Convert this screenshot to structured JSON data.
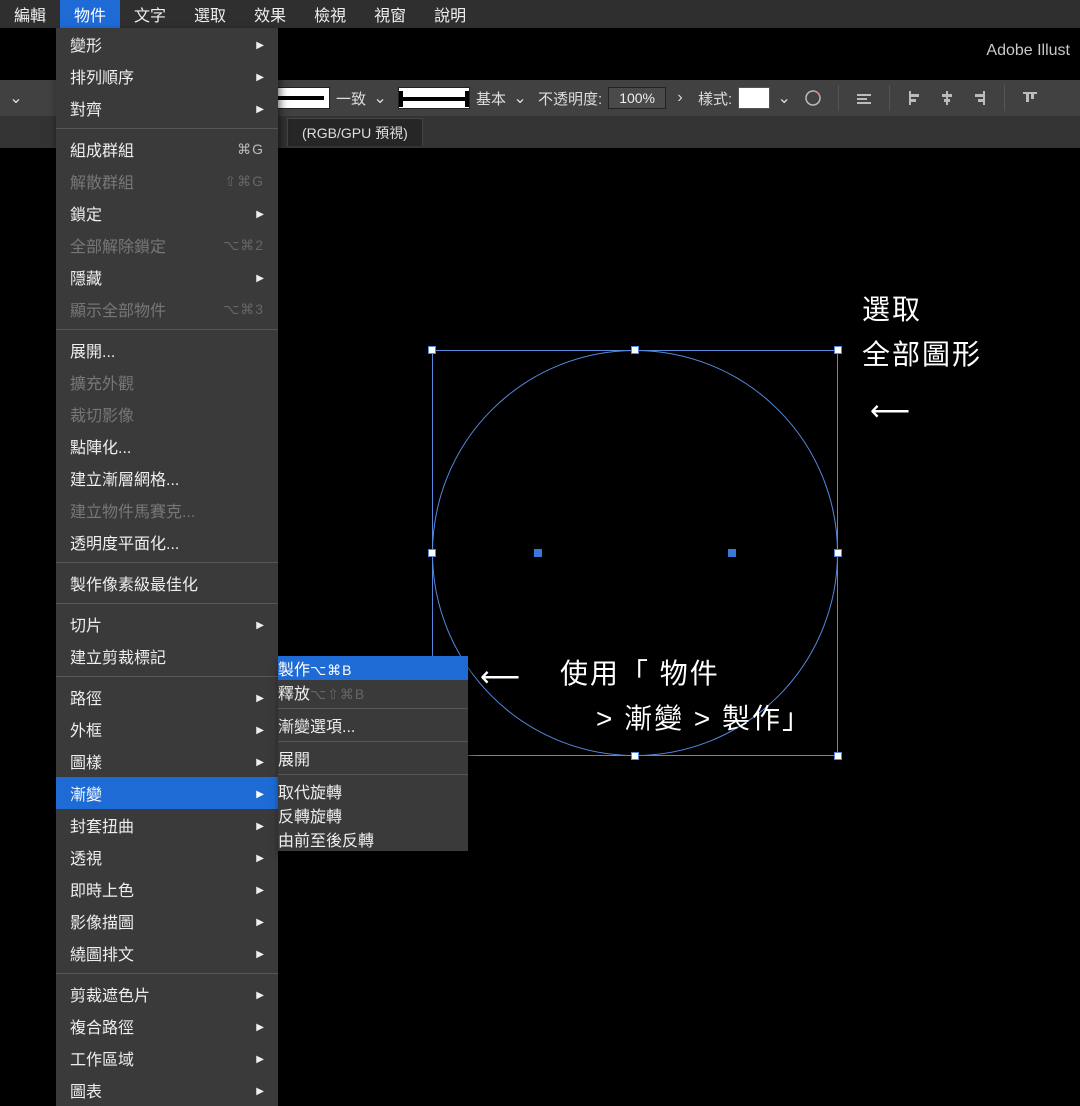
{
  "app": {
    "title": "Adobe Illust"
  },
  "menubar": {
    "items": [
      "編輯",
      "物件",
      "文字",
      "選取",
      "效果",
      "檢視",
      "視窗",
      "說明"
    ],
    "active_index": 1
  },
  "toolbar": {
    "stroke_preview_label": "一致",
    "profile_label": "基本",
    "opacity_label": "不透明度:",
    "opacity_value": "100%",
    "style_label": "樣式:"
  },
  "document": {
    "left_label": "預視)",
    "tab": "(RGB/GPU 預視)"
  },
  "menu": {
    "groups": [
      [
        {
          "label": "變形",
          "arrow": true
        },
        {
          "label": "排列順序",
          "arrow": true
        },
        {
          "label": "對齊",
          "arrow": true
        }
      ],
      [
        {
          "label": "組成群組",
          "shortcut": "⌘G"
        },
        {
          "label": "解散群組",
          "shortcut": "⇧⌘G",
          "disabled": true
        },
        {
          "label": "鎖定",
          "arrow": true
        },
        {
          "label": "全部解除鎖定",
          "shortcut": "⌥⌘2",
          "disabled": true
        },
        {
          "label": "隱藏",
          "arrow": true
        },
        {
          "label": "顯示全部物件",
          "shortcut": "⌥⌘3",
          "disabled": true
        }
      ],
      [
        {
          "label": "展開..."
        },
        {
          "label": "擴充外觀",
          "disabled": true
        },
        {
          "label": "裁切影像",
          "disabled": true
        },
        {
          "label": "點陣化..."
        },
        {
          "label": "建立漸層網格..."
        },
        {
          "label": "建立物件馬賽克...",
          "disabled": true
        },
        {
          "label": "透明度平面化..."
        }
      ],
      [
        {
          "label": "製作像素級最佳化"
        }
      ],
      [
        {
          "label": "切片",
          "arrow": true
        },
        {
          "label": "建立剪裁標記"
        }
      ],
      [
        {
          "label": "路徑",
          "arrow": true
        },
        {
          "label": "外框",
          "arrow": true
        },
        {
          "label": "圖樣",
          "arrow": true
        },
        {
          "label": "漸變",
          "arrow": true,
          "highlight": true
        },
        {
          "label": "封套扭曲",
          "arrow": true
        },
        {
          "label": "透視",
          "arrow": true
        },
        {
          "label": "即時上色",
          "arrow": true
        },
        {
          "label": "影像描圖",
          "arrow": true
        },
        {
          "label": "繞圖排文",
          "arrow": true
        }
      ],
      [
        {
          "label": "剪裁遮色片",
          "arrow": true
        },
        {
          "label": "複合路徑",
          "arrow": true
        },
        {
          "label": "工作區域",
          "arrow": true
        },
        {
          "label": "圖表",
          "arrow": true
        }
      ]
    ]
  },
  "submenu": {
    "groups": [
      [
        {
          "label": "製作",
          "shortcut": "⌥⌘B",
          "highlight": true
        },
        {
          "label": "釋放",
          "shortcut": "⌥⇧⌘B",
          "disabled": true
        }
      ],
      [
        {
          "label": "漸變選項..."
        }
      ],
      [
        {
          "label": "展開",
          "disabled": true
        }
      ],
      [
        {
          "label": "取代旋轉",
          "disabled": true
        },
        {
          "label": "反轉旋轉",
          "disabled": true
        },
        {
          "label": "由前至後反轉",
          "disabled": true
        }
      ]
    ]
  },
  "annotations": {
    "right_top_line1": "選取",
    "right_top_line2": "全部圖形",
    "bottom_line1": "使用「 物件",
    "bottom_line2": "> 漸變 > 製作」",
    "arrow_glyph": "⟵"
  }
}
